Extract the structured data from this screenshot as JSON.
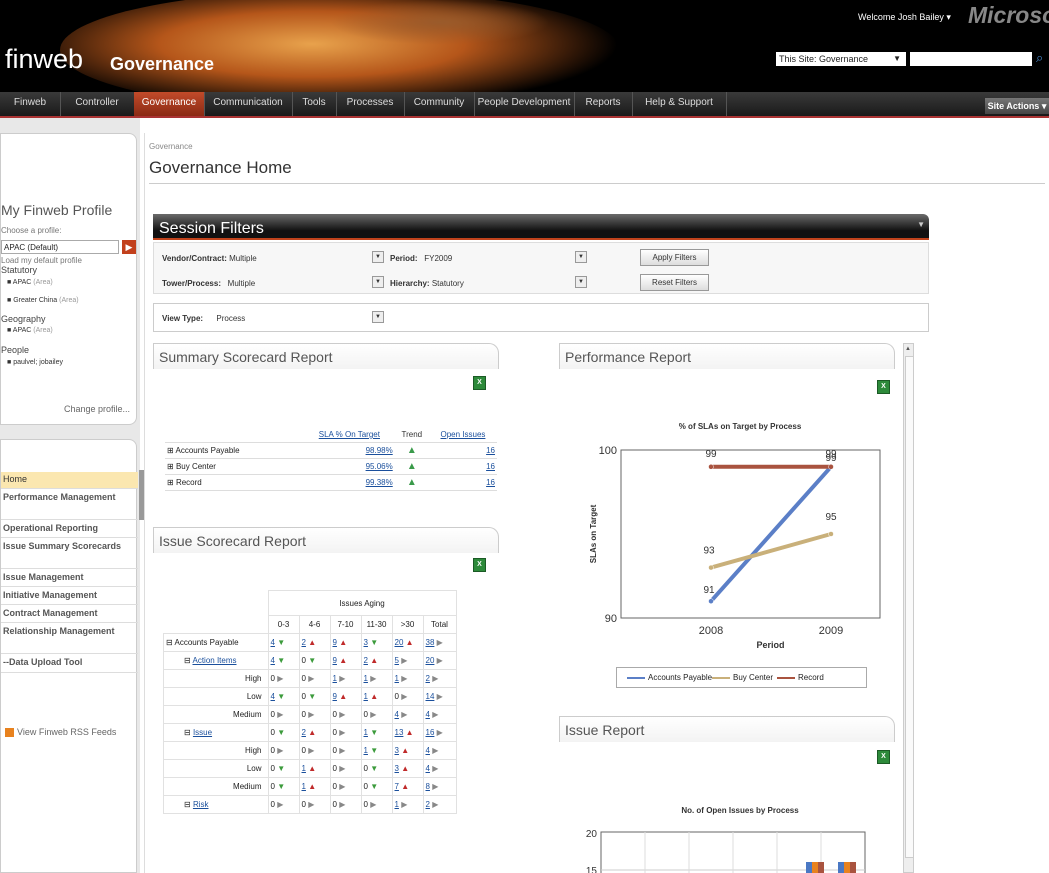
{
  "header": {
    "site_name": "finweb",
    "section_name": "Governance",
    "welcome": "Welcome Josh Bailey ▾",
    "brand": "Microsoft",
    "search_scope": "This Site: Governance"
  },
  "topnav": {
    "tabs": [
      "Finweb",
      "Controller",
      "Governance",
      "Communication",
      "Tools",
      "Processes",
      "Community",
      "People Development",
      "Reports",
      "Help & Support"
    ],
    "active": "Governance",
    "site_actions": "Site Actions ▾"
  },
  "profile": {
    "title": "My Finweb Profile",
    "choose_label": "Choose a profile:",
    "selected": "APAC (Default)",
    "load_default": "Load my default profile",
    "statutory_label": "Statutory",
    "statutory": [
      {
        "name": "APAC",
        "tag": "(Area)"
      },
      {
        "name": "Greater China",
        "tag": "(Area)"
      }
    ],
    "geography_label": "Geography",
    "geography": [
      {
        "name": "APAC",
        "tag": "(Area)"
      }
    ],
    "people_label": "People",
    "people": [
      {
        "name": "paulvel; jobailey",
        "tag": ""
      }
    ],
    "change": "Change profile..."
  },
  "leftnav": {
    "items": [
      "Home",
      "Performance Management",
      "Operational Reporting",
      "Issue Summary Scorecards",
      "Issue Management",
      "Initiative Management",
      "Contract Management",
      "Relationship Management",
      "--Data Upload Tool"
    ],
    "rss": "View Finweb RSS Feeds"
  },
  "page": {
    "breadcrumb": "Governance",
    "title": "Governance Home"
  },
  "filters": {
    "title": "Session Filters",
    "vendor_label": "Vendor/Contract:",
    "vendor_value": "Multiple",
    "tower_label": "Tower/Process:",
    "tower_value": "Multiple",
    "period_label": "Period:",
    "period_value": "FY2009",
    "hierarchy_label": "Hierarchy:",
    "hierarchy_value": "Statutory",
    "apply": "Apply Filters",
    "reset": "Reset Filters",
    "viewtype_label": "View Type:",
    "viewtype_value": "Process"
  },
  "summary": {
    "title": "Summary Scorecard Report",
    "headers": [
      "SLA % On Target",
      "Trend",
      "Open Issues"
    ],
    "rows": [
      {
        "name": "Accounts Payable",
        "pct": "98.98%",
        "issues": "16"
      },
      {
        "name": "Buy Center",
        "pct": "95.06%",
        "issues": "16"
      },
      {
        "name": "Record",
        "pct": "99.38%",
        "issues": "16"
      }
    ]
  },
  "issue_scorecard": {
    "title": "Issue Scorecard Report",
    "group_header": "Issues Aging",
    "columns": [
      "0-3",
      "4-6",
      "7-10",
      "11-30",
      ">30",
      "Total"
    ],
    "rows": [
      {
        "label": "Accounts Payable",
        "kind": "group",
        "cells": [
          [
            "4",
            "g"
          ],
          [
            "2",
            "r"
          ],
          [
            "9",
            "r"
          ],
          [
            "3",
            "g"
          ],
          [
            "20",
            "r"
          ],
          [
            "38",
            "gy"
          ]
        ]
      },
      {
        "label": "Action Items",
        "kind": "sub",
        "cells": [
          [
            "4",
            "g"
          ],
          [
            "0",
            "g"
          ],
          [
            "9",
            "r"
          ],
          [
            "2",
            "r"
          ],
          [
            "5",
            "gy"
          ],
          [
            "20",
            "gy"
          ]
        ]
      },
      {
        "label": "High",
        "kind": "leaf",
        "cells": [
          [
            "0",
            "gy"
          ],
          [
            "0",
            "gy"
          ],
          [
            "1",
            "gy"
          ],
          [
            "1",
            "gy"
          ],
          [
            "1",
            "gy"
          ],
          [
            "2",
            "gy"
          ]
        ]
      },
      {
        "label": "Low",
        "kind": "leaf",
        "cells": [
          [
            "4",
            "g"
          ],
          [
            "0",
            "g"
          ],
          [
            "9",
            "r"
          ],
          [
            "1",
            "r"
          ],
          [
            "0",
            "gy"
          ],
          [
            "14",
            "gy"
          ]
        ]
      },
      {
        "label": "Medium",
        "kind": "leaf",
        "cells": [
          [
            "0",
            "gy"
          ],
          [
            "0",
            "gy"
          ],
          [
            "0",
            "gy"
          ],
          [
            "0",
            "gy"
          ],
          [
            "4",
            "gy"
          ],
          [
            "4",
            "gy"
          ]
        ]
      },
      {
        "label": "Issue",
        "kind": "sub",
        "cells": [
          [
            "0",
            "g"
          ],
          [
            "2",
            "r"
          ],
          [
            "0",
            "gy"
          ],
          [
            "1",
            "g"
          ],
          [
            "13",
            "r"
          ],
          [
            "16",
            "gy"
          ]
        ]
      },
      {
        "label": "High",
        "kind": "leaf",
        "cells": [
          [
            "0",
            "gy"
          ],
          [
            "0",
            "gy"
          ],
          [
            "0",
            "gy"
          ],
          [
            "1",
            "g"
          ],
          [
            "3",
            "r"
          ],
          [
            "4",
            "gy"
          ]
        ]
      },
      {
        "label": "Low",
        "kind": "leaf",
        "cells": [
          [
            "0",
            "g"
          ],
          [
            "1",
            "r"
          ],
          [
            "0",
            "gy"
          ],
          [
            "0",
            "g"
          ],
          [
            "3",
            "r"
          ],
          [
            "4",
            "gy"
          ]
        ]
      },
      {
        "label": "Medium",
        "kind": "leaf",
        "cells": [
          [
            "0",
            "g"
          ],
          [
            "1",
            "r"
          ],
          [
            "0",
            "gy"
          ],
          [
            "0",
            "g"
          ],
          [
            "7",
            "r"
          ],
          [
            "8",
            "gy"
          ]
        ]
      },
      {
        "label": "Risk",
        "kind": "sub",
        "cells": [
          [
            "0",
            "gy"
          ],
          [
            "0",
            "gy"
          ],
          [
            "0",
            "gy"
          ],
          [
            "0",
            "gy"
          ],
          [
            "1",
            "gy"
          ],
          [
            "2",
            "gy"
          ]
        ]
      }
    ]
  },
  "performance": {
    "title": "Performance Report"
  },
  "issue_report": {
    "title": "Issue Report",
    "chart_title": "No. of Open Issues by Process",
    "y_ticks": [
      "20",
      "15"
    ]
  },
  "chart_data": {
    "type": "line",
    "title": "% of SLAs on Target by Process",
    "xlabel": "Period",
    "ylabel": "SLAs on Target",
    "x": [
      "2008",
      "2009"
    ],
    "ylim": [
      90,
      100
    ],
    "series": [
      {
        "name": "Accounts Payable",
        "values": [
          91,
          99
        ],
        "color": "#5b7fc7"
      },
      {
        "name": "Buy Center",
        "values": [
          93,
          95
        ],
        "color": "#c9b07a"
      },
      {
        "name": "Record",
        "values": [
          99,
          99
        ],
        "color": "#a9533f"
      }
    ]
  },
  "colors": {
    "accent": "#c2401c",
    "good": "#3c9b3c",
    "bad": "#c02a2a"
  }
}
